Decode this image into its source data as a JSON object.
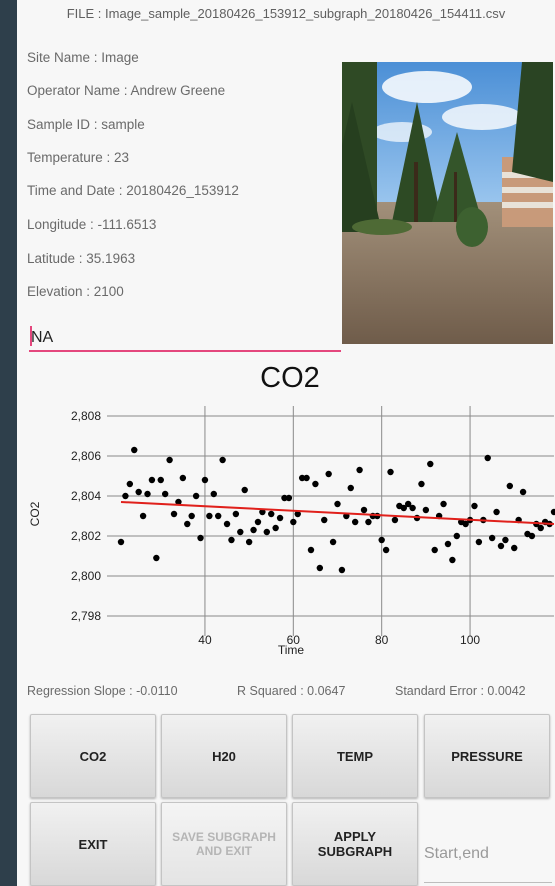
{
  "file_title": "FILE : Image_sample_20180426_153912_subgraph_20180426_154411.csv",
  "fields": [
    "Site  Name : Image",
    "Operator Name : Andrew Greene",
    "Sample ID : sample",
    "Temperature : 23",
    "Time and Date : 20180426_153912",
    "Longitude : -111.6513",
    "Latitude : 35.1963",
    "Elevation : 2100"
  ],
  "note_input": {
    "value": "NA"
  },
  "stats": {
    "slope": "Regression Slope : -0.0110",
    "r_squared": "R Squared : 0.0647",
    "std_error": "Standard Error : 0.0042"
  },
  "buttons": {
    "co2": "CO2",
    "h2o": "H20",
    "temp": "TEMP",
    "pressure": "PRESSURE",
    "exit": "EXIT",
    "save_subgraph": "SAVE SUBGRAPH AND EXIT",
    "apply_subgraph": "APPLY SUBGRAPH"
  },
  "range_input": {
    "placeholder": "Start,end"
  },
  "colors": {
    "accent": "#e4477d",
    "regression": "#e0201b",
    "points": "#000000",
    "grid": "#8a8a8a"
  },
  "chart_data": {
    "type": "scatter",
    "title": "CO2",
    "xlabel": "Time",
    "ylabel": "CO2",
    "xlim": [
      21,
      119
    ],
    "ylim": [
      2797.5,
      2808.5
    ],
    "x_ticks": [
      40,
      60,
      80,
      100
    ],
    "y_ticks": [
      2798,
      2800,
      2802,
      2804,
      2806,
      2808
    ],
    "x_tick_labels": [
      "40",
      "60",
      "80",
      "100"
    ],
    "y_tick_labels": [
      "2,798",
      "2,800",
      "2,802",
      "2,804",
      "2,806",
      "2,808"
    ],
    "grid": true,
    "regression": {
      "x": [
        21,
        119
      ],
      "y": [
        2803.7,
        2802.6
      ]
    },
    "points": [
      [
        21,
        2801.7
      ],
      [
        22,
        2804.0
      ],
      [
        23,
        2804.6
      ],
      [
        24,
        2806.3
      ],
      [
        25,
        2804.2
      ],
      [
        26,
        2803.0
      ],
      [
        27,
        2804.1
      ],
      [
        28,
        2804.8
      ],
      [
        29,
        2800.9
      ],
      [
        30,
        2804.8
      ],
      [
        31,
        2804.1
      ],
      [
        32,
        2805.8
      ],
      [
        33,
        2803.1
      ],
      [
        34,
        2803.7
      ],
      [
        35,
        2804.9
      ],
      [
        36,
        2802.6
      ],
      [
        37,
        2803.0
      ],
      [
        38,
        2804.0
      ],
      [
        39,
        2801.9
      ],
      [
        40,
        2804.8
      ],
      [
        41,
        2803.0
      ],
      [
        42,
        2804.1
      ],
      [
        43,
        2803.0
      ],
      [
        44,
        2805.8
      ],
      [
        45,
        2802.6
      ],
      [
        46,
        2801.8
      ],
      [
        47,
        2803.1
      ],
      [
        48,
        2802.2
      ],
      [
        49,
        2804.3
      ],
      [
        50,
        2801.7
      ],
      [
        51,
        2802.3
      ],
      [
        52,
        2802.7
      ],
      [
        53,
        2803.2
      ],
      [
        54,
        2802.2
      ],
      [
        55,
        2803.1
      ],
      [
        56,
        2802.4
      ],
      [
        57,
        2802.9
      ],
      [
        58,
        2803.9
      ],
      [
        59,
        2803.9
      ],
      [
        60,
        2802.7
      ],
      [
        61,
        2803.1
      ],
      [
        62,
        2804.9
      ],
      [
        63,
        2804.9
      ],
      [
        64,
        2801.3
      ],
      [
        65,
        2804.6
      ],
      [
        66,
        2800.4
      ],
      [
        67,
        2802.8
      ],
      [
        68,
        2805.1
      ],
      [
        69,
        2801.7
      ],
      [
        70,
        2803.6
      ],
      [
        71,
        2800.3
      ],
      [
        72,
        2803.0
      ],
      [
        73,
        2804.4
      ],
      [
        74,
        2802.7
      ],
      [
        75,
        2805.3
      ],
      [
        76,
        2803.3
      ],
      [
        77,
        2802.7
      ],
      [
        78,
        2803.0
      ],
      [
        79,
        2803.0
      ],
      [
        80,
        2801.8
      ],
      [
        81,
        2801.3
      ],
      [
        82,
        2805.2
      ],
      [
        83,
        2802.8
      ],
      [
        84,
        2803.5
      ],
      [
        85,
        2803.4
      ],
      [
        86,
        2803.6
      ],
      [
        87,
        2803.4
      ],
      [
        88,
        2802.9
      ],
      [
        89,
        2804.6
      ],
      [
        90,
        2803.3
      ],
      [
        91,
        2805.6
      ],
      [
        92,
        2801.3
      ],
      [
        93,
        2803.0
      ],
      [
        94,
        2803.6
      ],
      [
        95,
        2801.6
      ],
      [
        96,
        2800.8
      ],
      [
        97,
        2802.0
      ],
      [
        98,
        2802.7
      ],
      [
        99,
        2802.6
      ],
      [
        100,
        2802.8
      ],
      [
        101,
        2803.5
      ],
      [
        102,
        2801.7
      ],
      [
        103,
        2802.8
      ],
      [
        104,
        2805.9
      ],
      [
        105,
        2801.9
      ],
      [
        106,
        2803.2
      ],
      [
        107,
        2801.5
      ],
      [
        108,
        2801.8
      ],
      [
        109,
        2804.5
      ],
      [
        110,
        2801.4
      ],
      [
        111,
        2802.8
      ],
      [
        112,
        2804.2
      ],
      [
        113,
        2802.1
      ],
      [
        114,
        2802.0
      ],
      [
        115,
        2802.6
      ],
      [
        116,
        2802.4
      ],
      [
        117,
        2802.7
      ],
      [
        118,
        2802.6
      ],
      [
        119,
        2803.2
      ]
    ]
  }
}
